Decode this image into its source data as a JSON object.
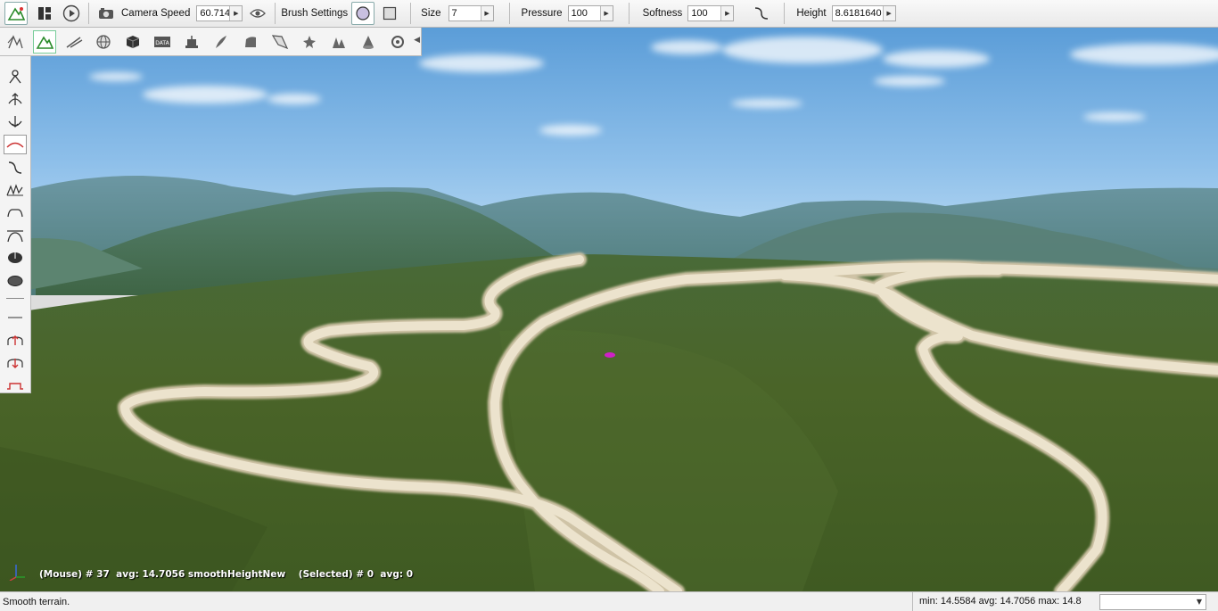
{
  "toolbar": {
    "camera_speed_label": "Camera Speed",
    "camera_speed_value": "60.714",
    "brush_settings_label": "Brush Settings",
    "size_label": "Size",
    "size_value": "7",
    "pressure_label": "Pressure",
    "pressure_value": "100",
    "softness_label": "Softness",
    "softness_value": "100",
    "height_label": "Height",
    "height_value": "8.6181640"
  },
  "overlay": {
    "mouse_info": "(Mouse) # 37  avg: 14.7056 smoothHeightNew",
    "selected_info": "(Selected) # 0  avg: 0"
  },
  "status": {
    "text": "Smooth terrain.",
    "stats": "min: 14.5584  avg: 14.7056  max: 14.8",
    "select_value": ""
  },
  "colors": {
    "sky_top": "#5e9fd8",
    "sky_horizon": "#bcdcf4",
    "hills_far": "#6d9ba6",
    "grass": "#49612a",
    "road": "#e6dcc4",
    "brush_marker": "#d020c8"
  },
  "icons": {
    "top": [
      "terrain-editor-icon",
      "layout-icon",
      "play-icon",
      "camera-icon",
      "eye-icon",
      "circle-brush-icon",
      "square-brush-icon",
      "softness-curve-icon"
    ],
    "tool_row": [
      "select-tool-icon",
      "terrain-tool-icon",
      "road-tool-icon",
      "sphere-tool-icon",
      "cube-tool-icon",
      "data-icon",
      "robot-icon",
      "feather-icon",
      "shape-icon",
      "sail-icon",
      "star-icon",
      "forest-icon",
      "cone-icon",
      "gear-icon"
    ],
    "palette": [
      "grab-icon",
      "raise-icon",
      "lower-icon",
      "smooth-icon",
      "slope-icon",
      "noise-icon",
      "flatten-icon",
      "set-height-icon",
      "hole-icon",
      "paint-icon",
      "mask-icon",
      "add-mask-icon",
      "subtract-mask-icon",
      "clear-mask-icon"
    ]
  }
}
